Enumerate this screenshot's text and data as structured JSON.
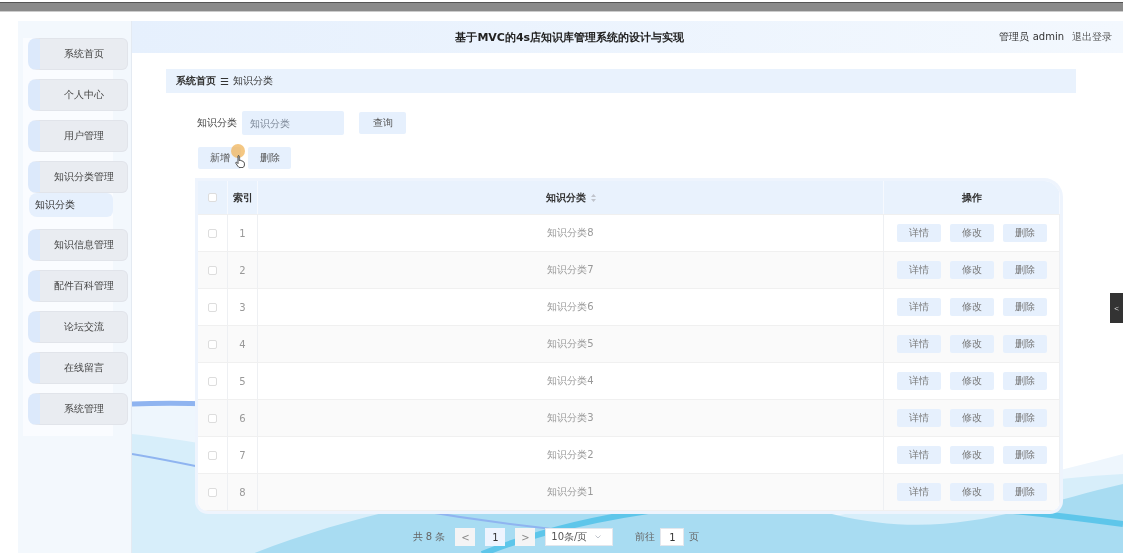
{
  "header": {
    "title": "基于MVC的4s店知识库管理系统的设计与实现",
    "user": "管理员 admin",
    "logout": "退出登录"
  },
  "sidebar": {
    "items": [
      {
        "label": "系统首页"
      },
      {
        "label": "个人中心"
      },
      {
        "label": "用户管理"
      },
      {
        "label": "知识分类管理",
        "children": [
          {
            "label": "知识分类",
            "selected": true
          }
        ]
      },
      {
        "label": "知识信息管理"
      },
      {
        "label": "配件百科管理"
      },
      {
        "label": "论坛交流"
      },
      {
        "label": "在线留言"
      },
      {
        "label": "系统管理"
      }
    ]
  },
  "breadcrumb": {
    "home": "系统首页",
    "separator": "☰",
    "current": "知识分类"
  },
  "search": {
    "label": "知识分类",
    "placeholder": "知识分类",
    "button": "查询"
  },
  "actions": [
    "新增",
    "删除"
  ],
  "table": {
    "all_checked": false,
    "columns": [
      "索引",
      "知识分类",
      "操作"
    ],
    "rows": [
      {
        "checked": false,
        "index": "1",
        "category": "知识分类8",
        "buttons": [
          "详情",
          "修改",
          "删除"
        ]
      },
      {
        "checked": false,
        "index": "2",
        "category": "知识分类7",
        "buttons": [
          "详情",
          "修改",
          "删除"
        ]
      },
      {
        "checked": false,
        "index": "3",
        "category": "知识分类6",
        "buttons": [
          "详情",
          "修改",
          "删除"
        ]
      },
      {
        "checked": false,
        "index": "4",
        "category": "知识分类5",
        "buttons": [
          "详情",
          "修改",
          "删除"
        ]
      },
      {
        "checked": false,
        "index": "5",
        "category": "知识分类4",
        "buttons": [
          "详情",
          "修改",
          "删除"
        ]
      },
      {
        "checked": false,
        "index": "6",
        "category": "知识分类3",
        "buttons": [
          "详情",
          "修改",
          "删除"
        ]
      },
      {
        "checked": false,
        "index": "7",
        "category": "知识分类2",
        "buttons": [
          "详情",
          "修改",
          "删除"
        ]
      },
      {
        "checked": false,
        "index": "8",
        "category": "知识分类1",
        "buttons": [
          "详情",
          "修改",
          "删除"
        ]
      }
    ]
  },
  "pagination": {
    "total": "共 8 条",
    "prev": "<",
    "pages": [
      {
        "label": "1",
        "selected": true
      }
    ],
    "next": ">",
    "page_size": "10条/页",
    "goto": "前往",
    "goto_value": "1",
    "goto_suffix": "页"
  },
  "side_tab": "<"
}
